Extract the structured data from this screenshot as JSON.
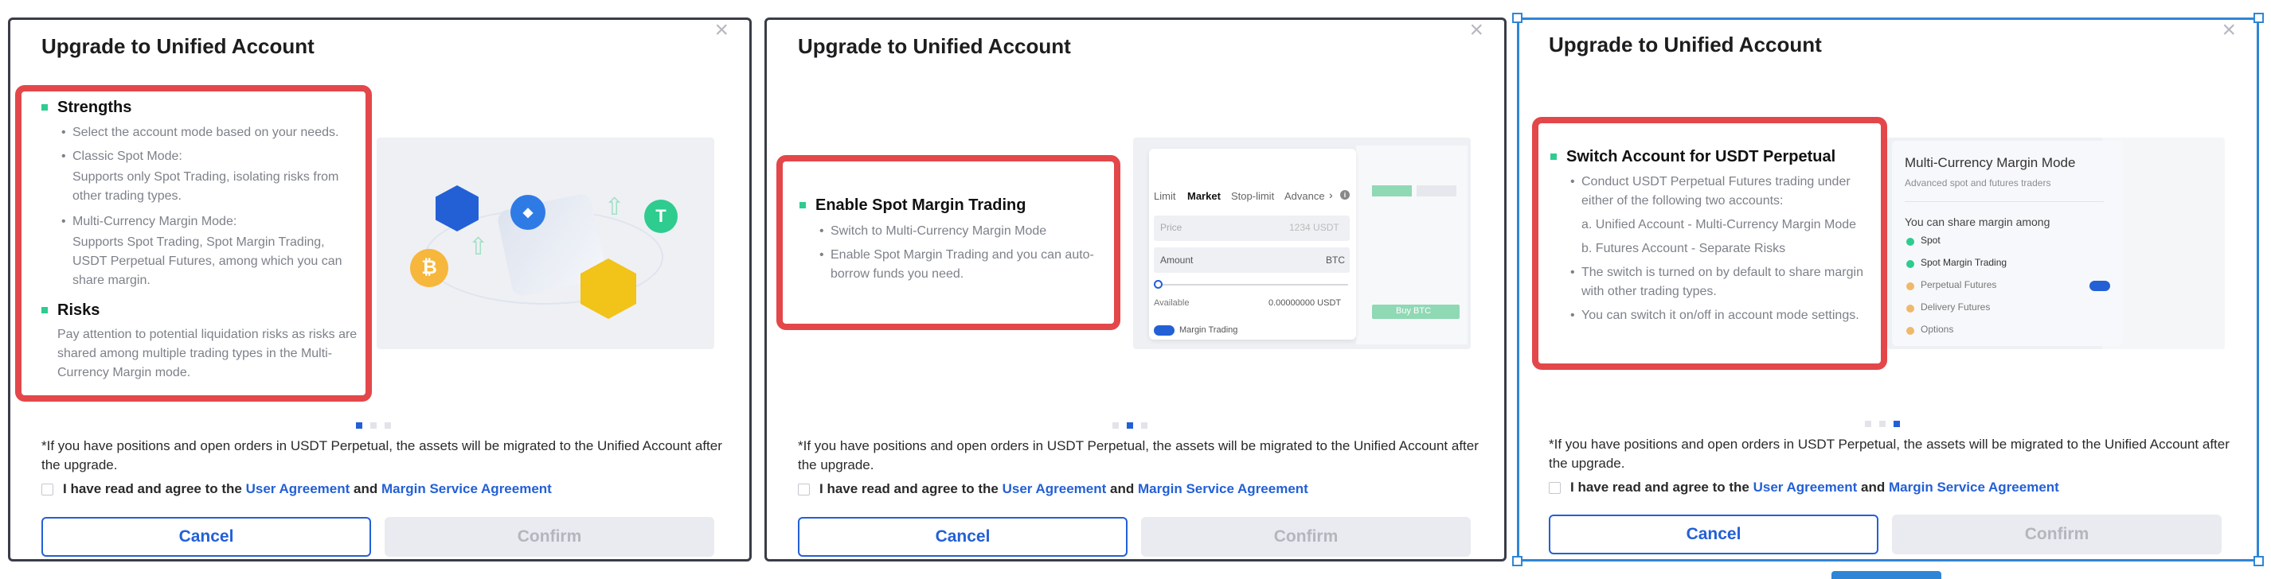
{
  "dialog": {
    "title": "Upgrade to Unified Account",
    "close_glyph": "×",
    "note": "*If you have positions and open orders in USDT Perpetual, the assets will be migrated to the Unified Account after the upgrade.",
    "agree_prefix": "I have read and agree to the",
    "user_agreement": "User Agreement",
    "and": "and",
    "margin_agreement": "Margin Service Agreement",
    "cancel": "Cancel",
    "confirm": "Confirm"
  },
  "slide1": {
    "strengths_title": "Strengths",
    "strengths_items": [
      "Select the account mode based on your needs.",
      "Classic Spot Mode:",
      "Multi-Currency Margin Mode:"
    ],
    "classic_desc": "Supports only Spot Trading, isolating risks from other trading types.",
    "multi_desc": "Supports Spot Trading, Spot Margin Trading, USDT Perpetual Futures, among which you can share margin.",
    "risks_title": "Risks",
    "risks_desc": "Pay attention to potential liquidation risks as risks are shared among multiple trading types in the Multi-Currency Margin mode.",
    "active_dot": 0
  },
  "slide2": {
    "section_title": "Enable Spot Margin Trading",
    "items": [
      "Switch to Multi-Currency Margin Mode",
      "Enable Spot Margin Trading and you can auto-borrow funds you need."
    ],
    "trade_tabs": [
      "Limit",
      "Market",
      "Stop-limit",
      "Advance"
    ],
    "price_label": "Price",
    "price_value": "1234 USDT",
    "amount_label": "Amount",
    "amount_unit": "BTC",
    "available_label": "Available",
    "available_value": "0.00000000 USDT",
    "margin_toggle": "Margin Trading",
    "buy_btn": "Buy BTC",
    "active_dot": 1
  },
  "slide3": {
    "section_title": "Switch Account for USDT Perpetual",
    "items": [
      "Conduct USDT Perpetual Futures trading under either of the following two accounts:",
      "The switch is turned on by default to share margin with other trading types.",
      "You can switch it on/off in account mode settings."
    ],
    "option_a": "a. Unified Account - Multi-Currency Margin Mode",
    "option_b": "b. Futures Account - Separate Risks",
    "card_title": "Multi-Currency Margin Mode",
    "card_sub": "Advanced spot and futures traders",
    "share_title": "You can share margin among",
    "share_items": [
      "Spot",
      "Spot Margin Trading",
      "Perpetual Futures",
      "Delivery Futures",
      "Options"
    ],
    "active_dot": 2
  },
  "colors": {
    "accent": "#2360d6",
    "highlight": "#e3474a",
    "bullet": "#2ecc8f",
    "border_selected": "#2f86d6"
  },
  "icons": [
    "close-icon",
    "shield-icon",
    "ethereum-icon",
    "bitcoin-icon",
    "tether-icon",
    "wallet-icon",
    "arrow-up-icon",
    "info-icon",
    "toggle-icon",
    "checkbox-icon"
  ]
}
